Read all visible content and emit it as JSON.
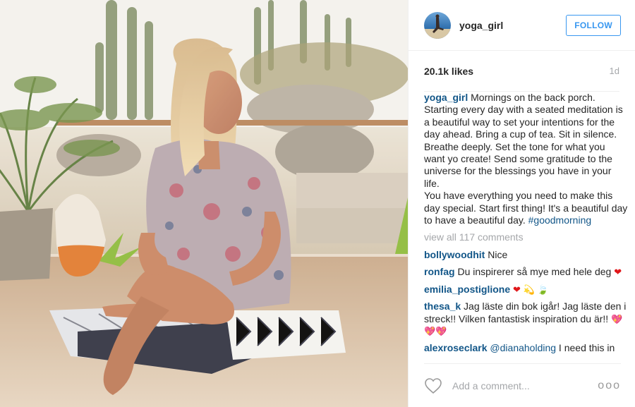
{
  "post": {
    "username": "yoga_girl",
    "follow_label": "FOLLOW",
    "likes": "20.1k likes",
    "time": "1d"
  },
  "caption": {
    "user": "yoga_girl",
    "text_1": " Mornings on the back porch. Starting every day with a seated meditation is a beautiful way to set your intentions for the day ahead. Bring a cup of tea. Sit in silence. Breathe deeply. Set the tone for what you want yo create! Send some gratitude to the universe for the blessings you have in your life.",
    "text_2": "You have everything you need to make this day special. Start first thing! It's a beautiful day to have a beautiful day. ",
    "hashtag": "#goodmorning"
  },
  "view_all": "view all 117 comments",
  "comments": [
    {
      "user": "bollywoodhit",
      "text": " Nice"
    },
    {
      "user": "ronfag",
      "text": " Du inspirerer så mye med hele deg ",
      "emoji": "❤"
    },
    {
      "user": "emilia_postiglione",
      "text": " ",
      "emoji": "❤ 💫 🍃"
    },
    {
      "user": "thesa_k",
      "text": " Jag läste din bok igår! Jag läste den i streck!! Vilken fantastisk inspiration du är!! ",
      "emoji": "💖💖💖"
    },
    {
      "user": "alexroseclark",
      "mention": " @dianaholding",
      "text": " I need this in"
    }
  ],
  "footer": {
    "add_comment_placeholder": "Add a comment...",
    "more_label": "ooo"
  },
  "icons": {
    "like": "heart-outline-icon",
    "more": "more-options-icon"
  },
  "colors": {
    "follow_blue": "#3897f0",
    "link_blue": "#125688",
    "muted_gray": "#a5a7aa"
  }
}
